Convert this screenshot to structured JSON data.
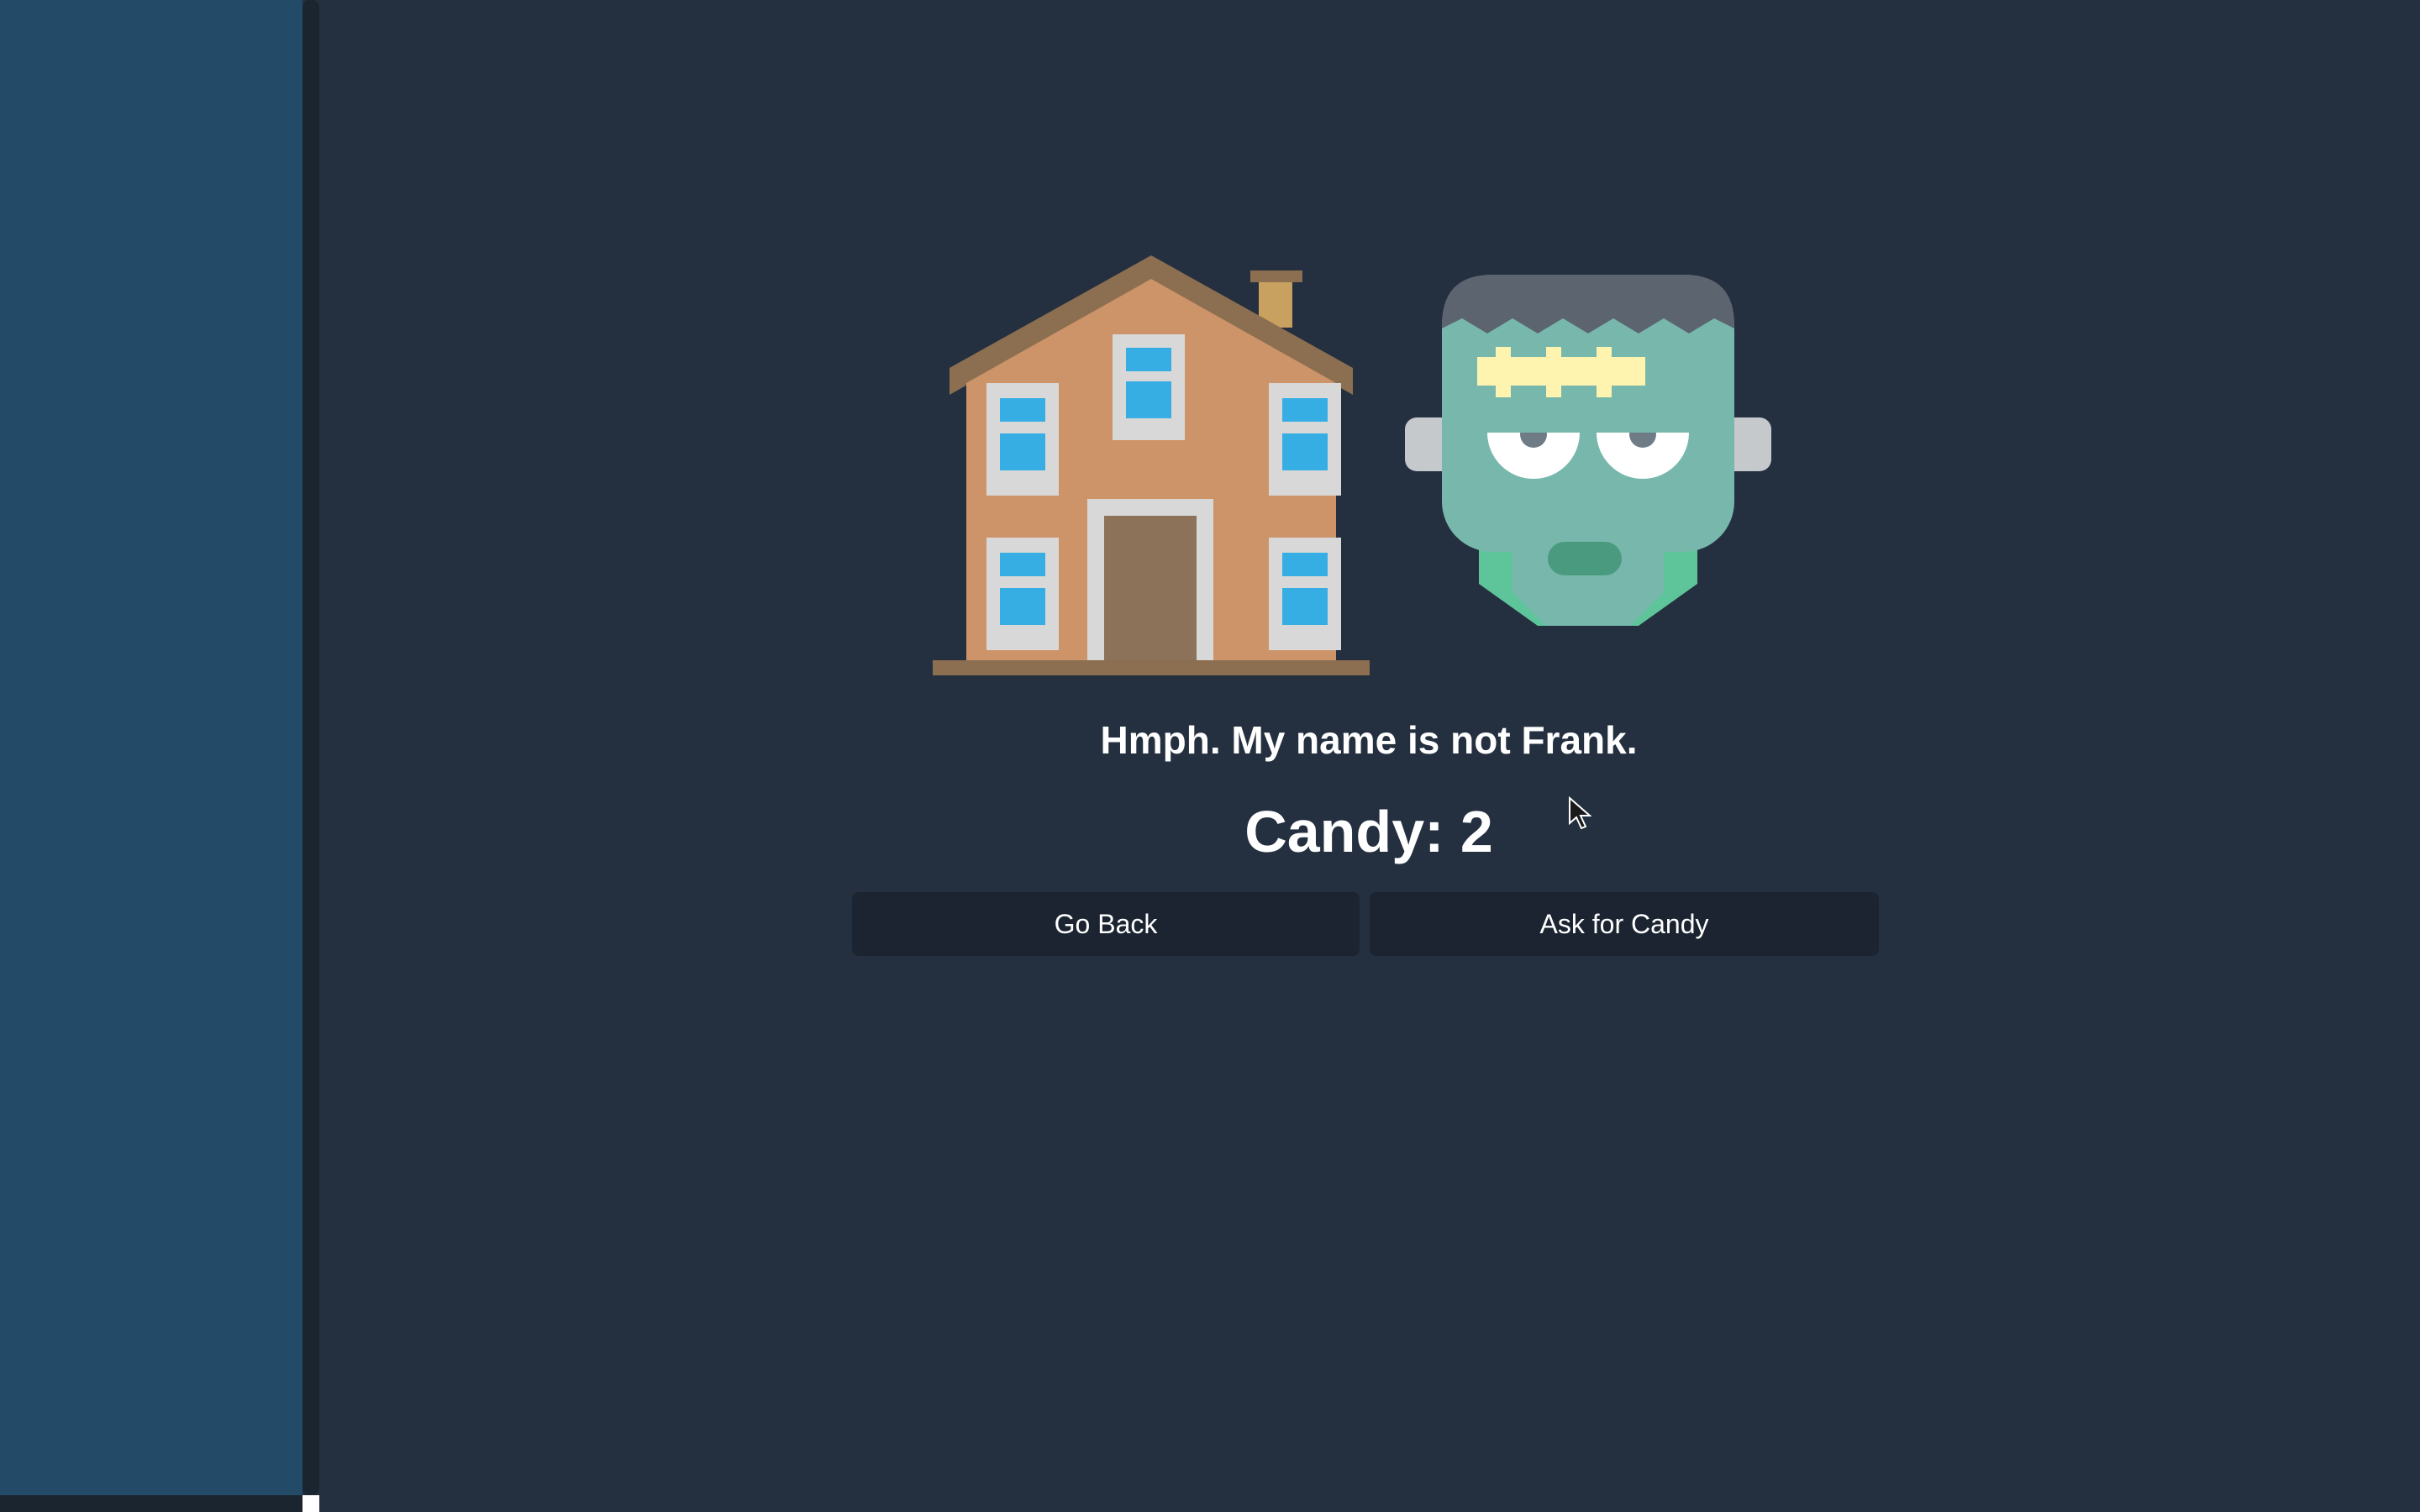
{
  "scene": {
    "house_icon": "house-icon",
    "monster_icon": "frankenstein-monster-icon"
  },
  "dialog": {
    "message": "Hmph. My name is not Frank."
  },
  "status": {
    "candy_label": "Candy: 2",
    "candy_count": 2
  },
  "actions": {
    "go_back_label": "Go Back",
    "ask_label": "Ask for Candy"
  },
  "colors": {
    "background": "#243040",
    "sidebar": "#234a66",
    "button": "#1b2430",
    "text": "#ffffff"
  }
}
